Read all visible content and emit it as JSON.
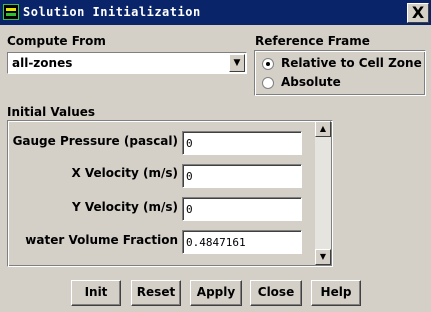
{
  "window": {
    "title": "Solution Initialization",
    "close_glyph": "X"
  },
  "compute_from": {
    "label": "Compute From",
    "value": "all-zones",
    "arrow_glyph": "▼"
  },
  "reference_frame": {
    "label": "Reference Frame",
    "options": [
      {
        "label": "Relative to Cell Zone",
        "selected": true
      },
      {
        "label": "Absolute",
        "selected": false
      }
    ]
  },
  "initial_values": {
    "label": "Initial Values",
    "fields": [
      {
        "label": "Gauge Pressure (pascal)",
        "value": "0"
      },
      {
        "label": "X Velocity (m/s)",
        "value": "0"
      },
      {
        "label": "Y Velocity (m/s)",
        "value": "0"
      },
      {
        "label": "water Volume Fraction",
        "value": "0.4847161"
      }
    ],
    "scroll_up_glyph": "▲",
    "scroll_down_glyph": "▼"
  },
  "buttons": {
    "init": "Init",
    "reset": "Reset",
    "apply": "Apply",
    "close": "Close",
    "help": "Help"
  },
  "icons": {
    "app": "fluent-app-icon",
    "close": "close-icon"
  }
}
